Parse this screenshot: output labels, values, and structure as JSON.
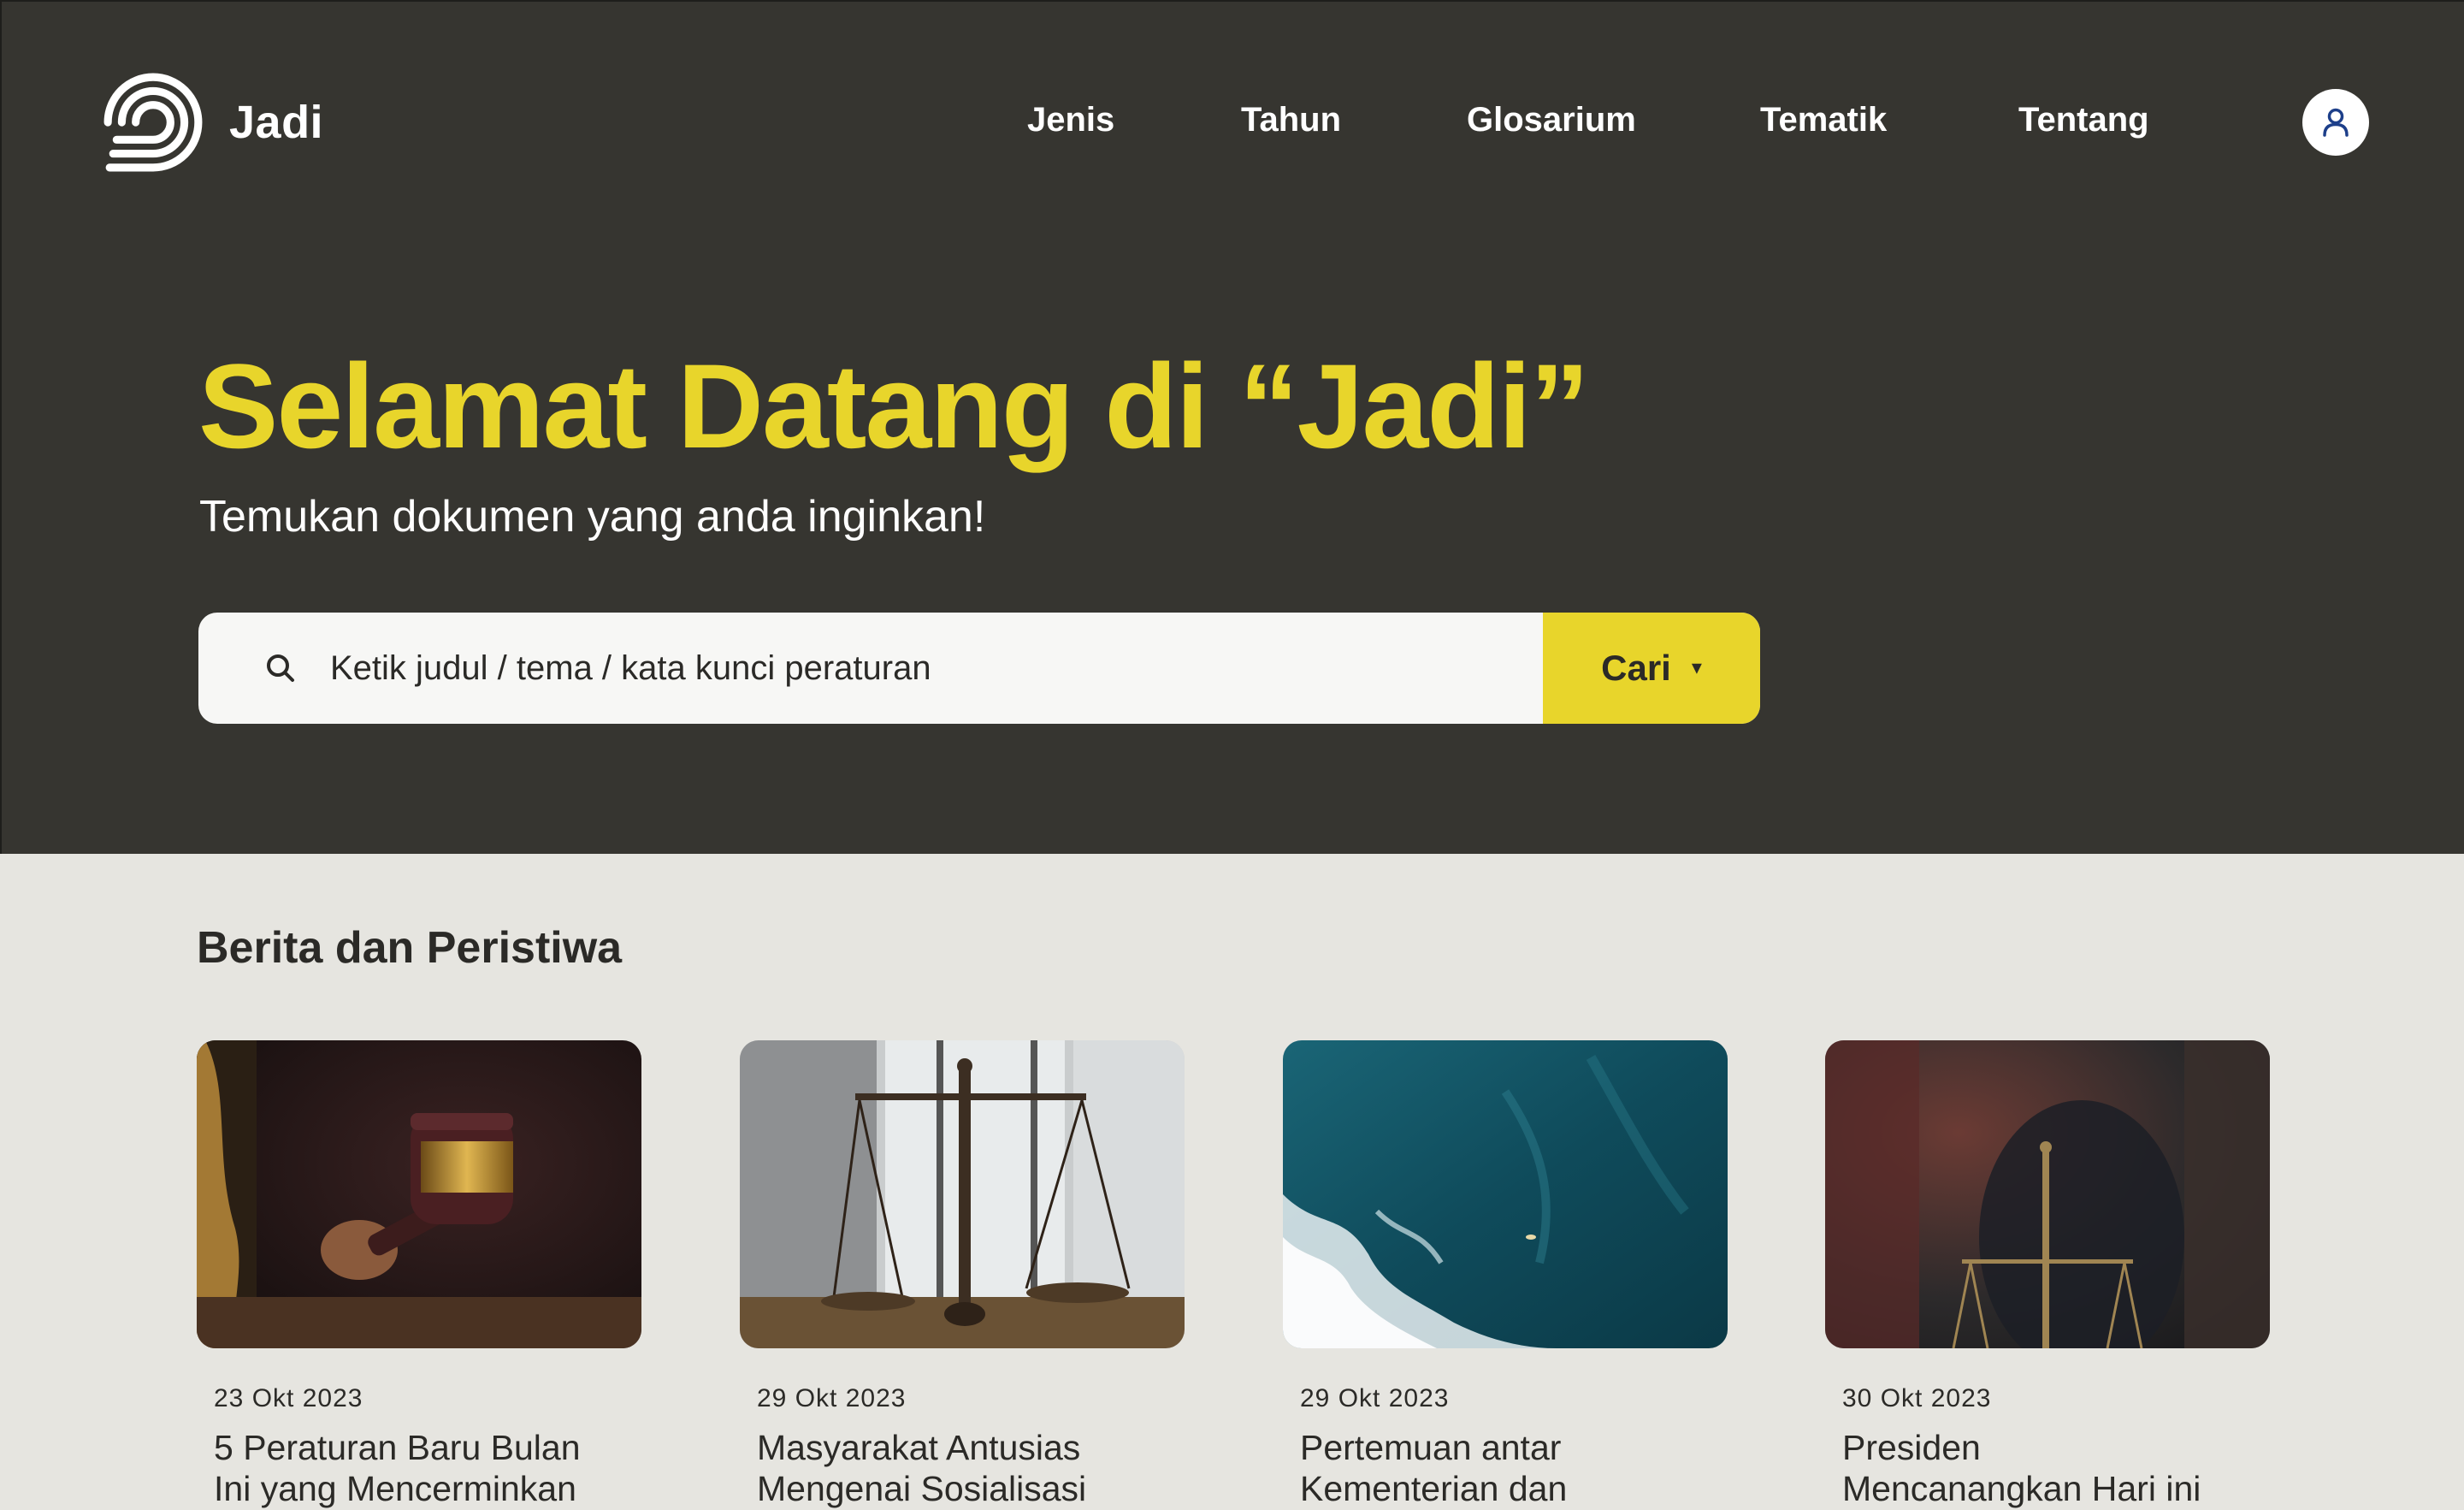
{
  "header": {
    "brand": "Jadi",
    "logo_icon": "concentric-arcs-logo-icon",
    "nav": [
      {
        "label": "Jenis"
      },
      {
        "label": "Tahun"
      },
      {
        "label": "Glosarium"
      },
      {
        "label": "Tematik"
      },
      {
        "label": "Tentang"
      }
    ],
    "account_icon": "user-icon"
  },
  "hero": {
    "title": "Selamat Datang di “Jadi”",
    "subtitle": "Temukan dokumen yang anda inginkan!",
    "search": {
      "placeholder": "Ketik judul / tema / kata kunci peraturan",
      "value": "",
      "button_label": "Cari",
      "button_caret": "▾",
      "icon": "search-icon"
    }
  },
  "news": {
    "section_title": "Berita dan Peristiwa",
    "items": [
      {
        "date": "23 Okt 2023",
        "title": "5 Peraturan Baru Bulan Ini yang Mencerminkan",
        "image": "gavel-photo"
      },
      {
        "date": "29 Okt 2023",
        "title": "Masyarakat Antusias Mengenai Sosialisasi",
        "image": "scales-of-justice-photo"
      },
      {
        "date": "29 Okt 2023",
        "title": "Pertemuan antar Kementerian dan",
        "image": "ocean-aerial-photo"
      },
      {
        "date": "30 Okt 2023",
        "title": "Presiden Mencanangkan Hari ini",
        "image": "blurred-scales-photo"
      }
    ]
  },
  "colors": {
    "header_bg": "#363530",
    "accent": "#e8d52b",
    "page_bg": "#e6e5e0",
    "text_dark": "#2b2a27",
    "user_icon": "#1d3f8a"
  }
}
